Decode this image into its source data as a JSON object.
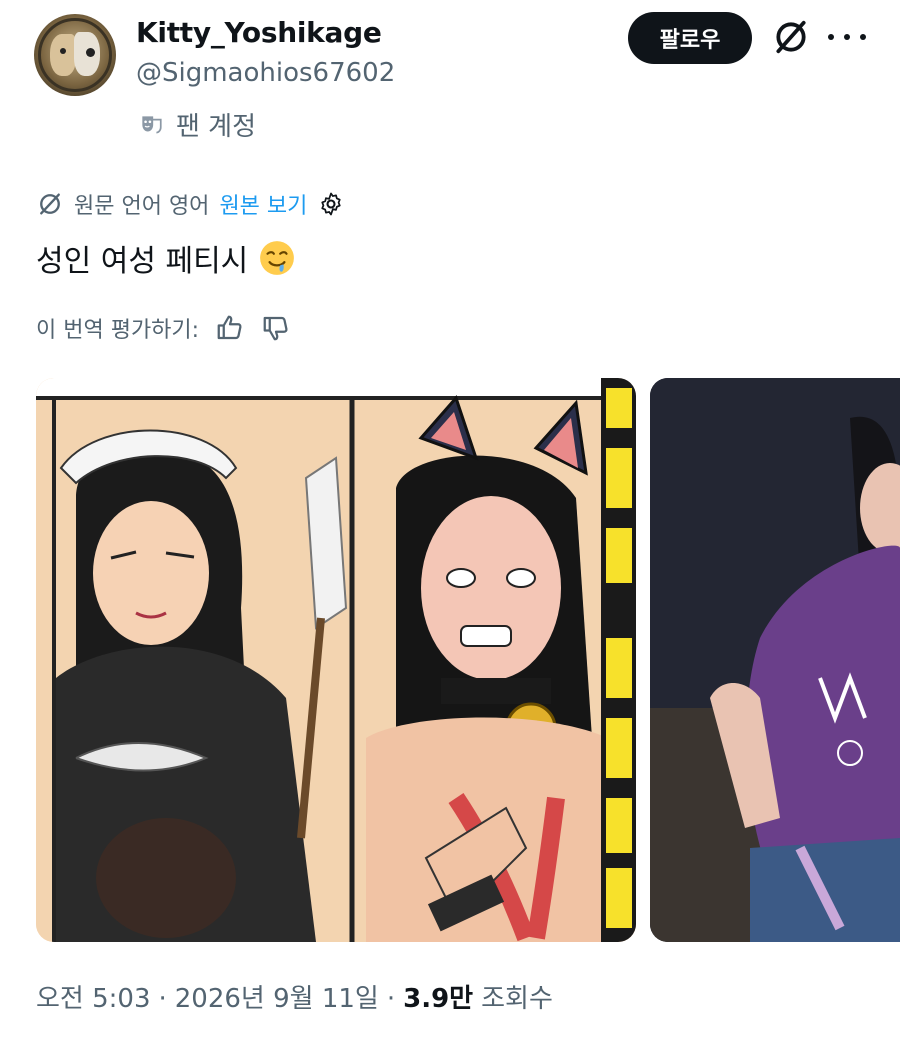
{
  "user": {
    "display_name": "Kitty_Yoshikage",
    "handle": "@Sigmaohios67602",
    "account_label": "팬 계정"
  },
  "actions": {
    "follow_label": "팔로우"
  },
  "translation": {
    "source_text": "원문 언어 영어",
    "show_original_label": "원본 보기",
    "rate_label": "이 번역 평가하기:"
  },
  "tweet": {
    "text": "성인 여성 페티시"
  },
  "meta": {
    "time": "오전 5:03",
    "separator": "·",
    "date": "2026년 9월 11일",
    "views_count": "3.9만",
    "views_label": "조회수"
  },
  "colors": {
    "text_primary": "#0f1419",
    "text_secondary": "#536471",
    "accent": "#1d9bf0",
    "follow_bg": "#0f1419"
  },
  "icons": [
    "avatar",
    "theater-mask-icon",
    "grok-icon",
    "more-icon",
    "translate-icon",
    "settings-gear-icon",
    "drooling-emoji-icon",
    "thumbs-up-icon",
    "thumbs-down-icon"
  ]
}
